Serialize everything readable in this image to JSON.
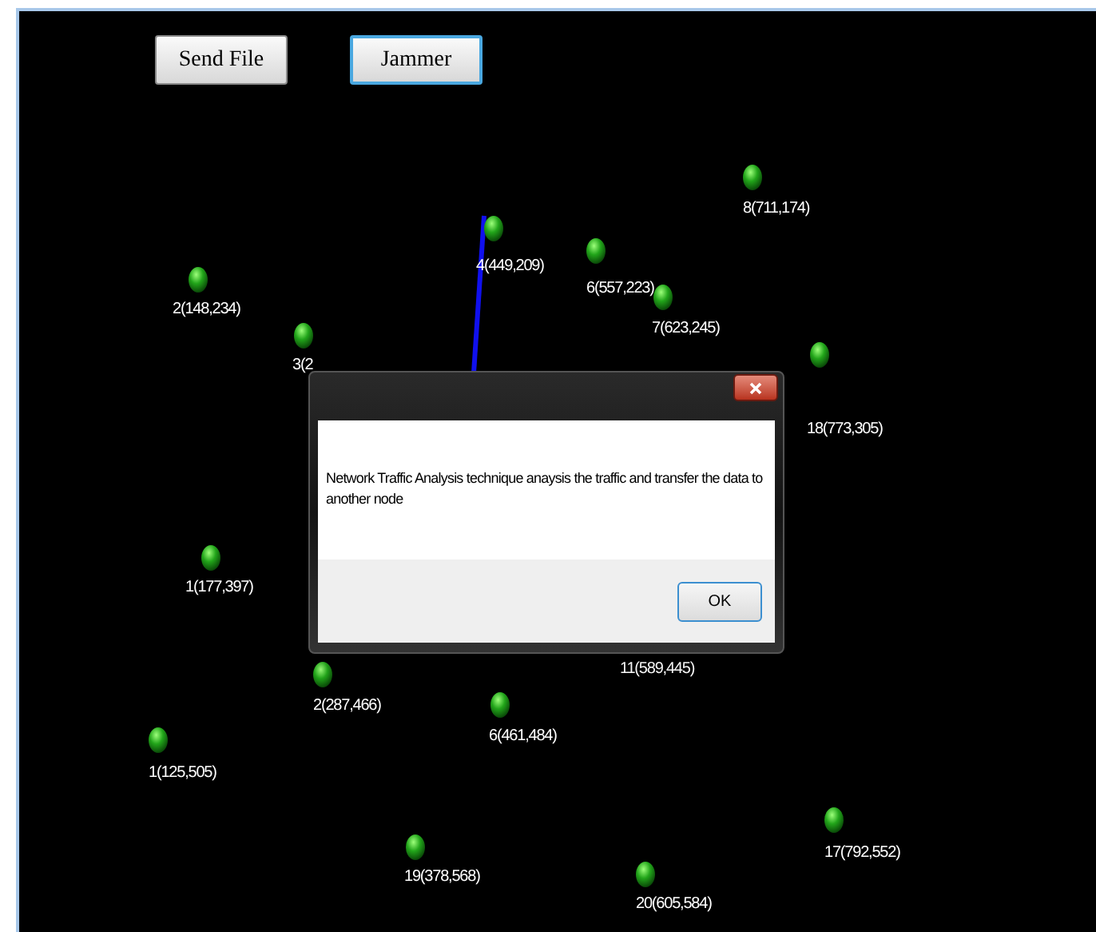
{
  "buttons": [
    {
      "label": "Send File",
      "focused": false
    },
    {
      "label": "Jammer",
      "focused": true
    }
  ],
  "nodes": [
    {
      "label": "8(711,174)"
    },
    {
      "label": "4(449,209)"
    },
    {
      "label": "6(557,223)"
    },
    {
      "label": "2(148,234)"
    },
    {
      "label": "7(623,245)"
    },
    {
      "label": "3(2"
    },
    {
      "label": "18(773,305)"
    },
    {
      "label": "1(177,397)"
    },
    {
      "label": "11(589,445)"
    },
    {
      "label": "2(287,466)"
    },
    {
      "label": "6(461,484)"
    },
    {
      "label": "1(125,505)"
    },
    {
      "label": "17(792,552)"
    },
    {
      "label": "19(378,568)"
    },
    {
      "label": "20(605,584)"
    }
  ],
  "dialog": {
    "message": "Network Traffic Analysis technique anaysis the traffic and transfer the data to another node",
    "ok_button": "OK"
  }
}
